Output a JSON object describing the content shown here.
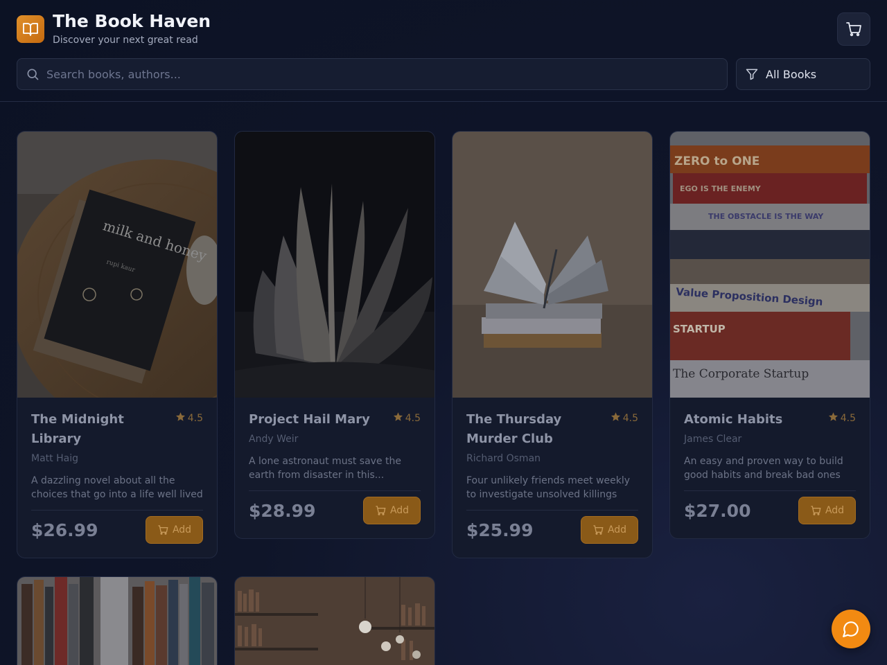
{
  "header": {
    "title": "The Book Haven",
    "subtitle": "Discover your next great read"
  },
  "search": {
    "placeholder": "Search books, authors..."
  },
  "filter": {
    "label": "All Books"
  },
  "books": [
    {
      "title": "The Midnight Library",
      "author": "Matt Haig",
      "rating": "4.5",
      "description": "A dazzling novel about all the choices that go into a life well lived",
      "price": "$26.99",
      "add_label": "Add",
      "cover_text": "milk and honey"
    },
    {
      "title": "Project Hail Mary",
      "author": "Andy Weir",
      "rating": "4.5",
      "description": "A lone astronaut must save the earth from disaster in this...",
      "price": "$28.99",
      "add_label": "Add"
    },
    {
      "title": "The Thursday Murder Club",
      "author": "Richard Osman",
      "rating": "4.5",
      "description": "Four unlikely friends meet weekly to investigate unsolved killings",
      "price": "$25.99",
      "add_label": "Add"
    },
    {
      "title": "Atomic Habits",
      "author": "James Clear",
      "rating": "4.5",
      "description": "An easy and proven way to build good habits and break bad ones",
      "price": "$27.00",
      "add_label": "Add",
      "spine_texts": [
        "ZERO to ONE",
        "EGO IS THE ENEMY",
        "THE OBSTACLE IS THE WAY",
        "Value Proposition Design",
        "STARTUP",
        "The Corporate Startup"
      ]
    }
  ],
  "colors": {
    "accent": "#f28a12",
    "background": "#0f1529"
  }
}
